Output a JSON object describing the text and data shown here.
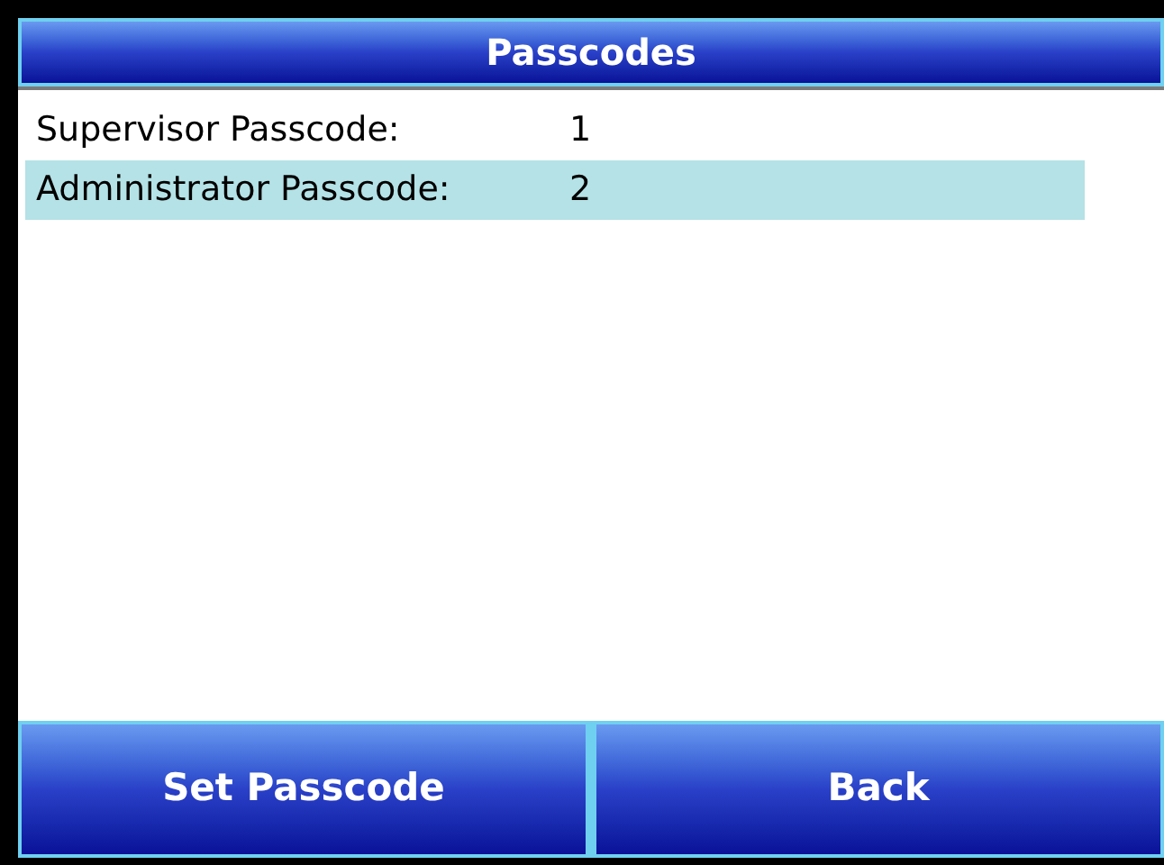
{
  "title": "Passcodes",
  "rows": [
    {
      "label": "Supervisor Passcode:",
      "value": "1",
      "selected": false
    },
    {
      "label": "Administrator Passcode:",
      "value": "2",
      "selected": true
    }
  ],
  "buttons": [
    "Set Passcode",
    "Back"
  ]
}
